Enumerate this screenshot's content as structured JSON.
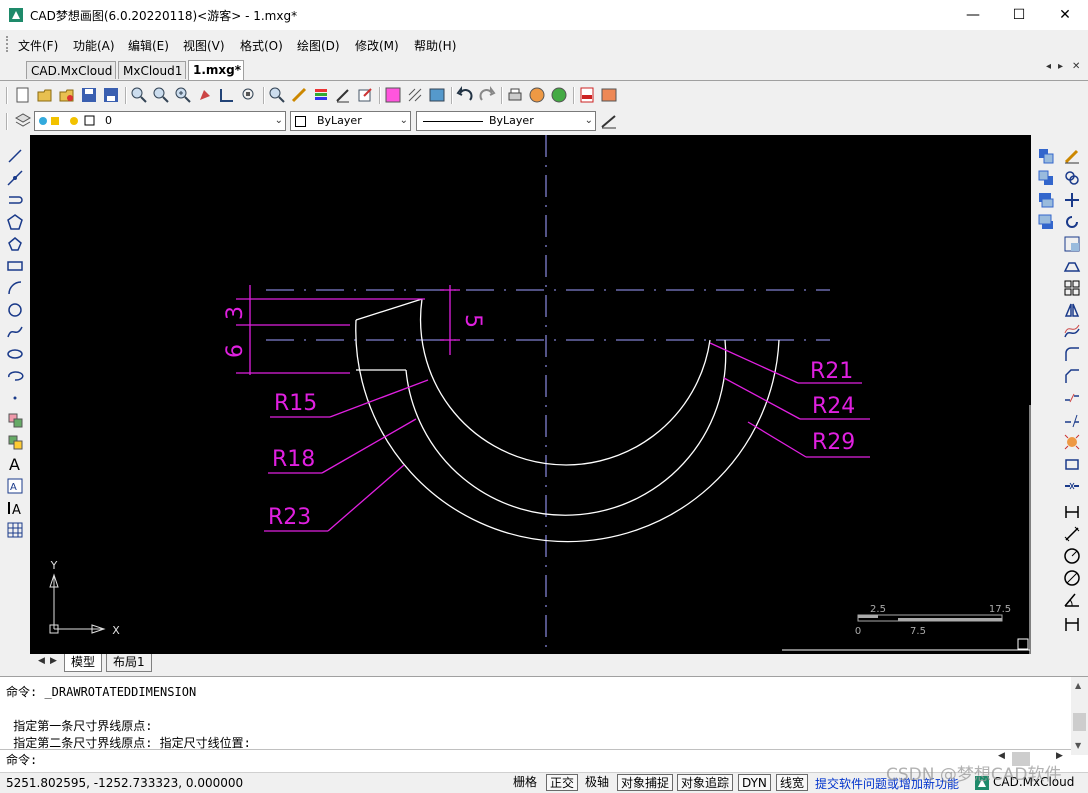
{
  "window": {
    "title": "CAD梦想画图(6.0.20220118)<游客> - 1.mxg*",
    "minimize": "—",
    "maximize": "☐",
    "close": "✕"
  },
  "menu": [
    "文件(F)",
    "功能(A)",
    "编辑(E)",
    "视图(V)",
    "格式(O)",
    "绘图(D)",
    "修改(M)",
    "帮助(H)"
  ],
  "doc_tabs": [
    {
      "label": "CAD.MxCloud",
      "active": false
    },
    {
      "label": "MxCloud1",
      "active": false
    },
    {
      "label": "1.mxg*",
      "active": true
    }
  ],
  "tab_nav": {
    "prev": "◂",
    "next": "▸",
    "close": "✕"
  },
  "layer_combo": {
    "value": "0"
  },
  "color_combo": {
    "value": "ByLayer"
  },
  "linetype_combo": {
    "value": "ByLayer"
  },
  "drawing": {
    "dims": {
      "d3": "3",
      "d6": "6",
      "d5": "5"
    },
    "labels": {
      "r15": "R15",
      "r18": "R18",
      "r23": "R23",
      "r21": "R21",
      "r24": "R24",
      "r29": "R29"
    },
    "ucs": {
      "y": "Y",
      "x": "X"
    },
    "scalebar": {
      "t1": "2.5",
      "t2": "17.5",
      "b1": "0",
      "b2": "7.5"
    },
    "colors": {
      "dimension": "#e020e0",
      "centerline": "#8080d0",
      "geometry": "#ffffff",
      "background": "#000000"
    }
  },
  "layout_tabs": [
    {
      "label": "模型",
      "active": true
    },
    {
      "label": "布局1",
      "active": false
    }
  ],
  "command": {
    "line1": "命令: _DRAWROTATEDDIMENSION",
    "line2": " 指定第一条尺寸界线原点:",
    "line3": " 指定第二条尺寸界线原点: 指定尺寸线位置:",
    "prompt": "命令:"
  },
  "status": {
    "coords": "5251.802595,  -1252.733323,  0.000000",
    "buttons": [
      {
        "label": "栅格",
        "on": false
      },
      {
        "label": "正交",
        "on": true
      },
      {
        "label": "极轴",
        "on": false
      },
      {
        "label": "对象捕捉",
        "on": true
      },
      {
        "label": "对象追踪",
        "on": true
      },
      {
        "label": "DYN",
        "on": true
      },
      {
        "label": "线宽",
        "on": true
      }
    ],
    "link": "提交软件问题或增加新功能",
    "brand": "CAD.MxCloud"
  },
  "watermark": "CSDN @梦想CAD软件"
}
